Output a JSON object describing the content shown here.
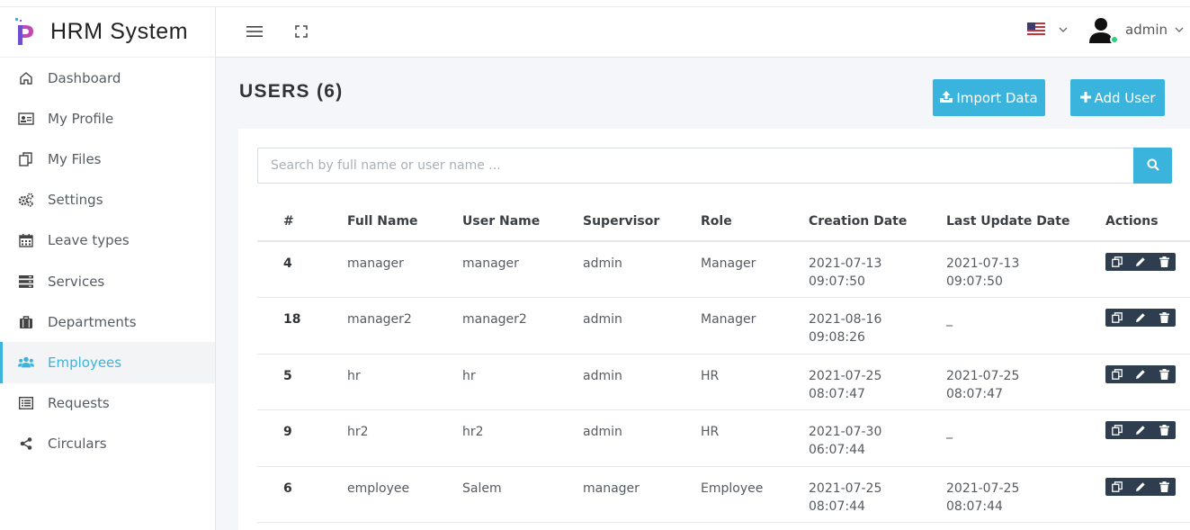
{
  "app": {
    "title": "HRM System"
  },
  "sidebar": {
    "items": [
      {
        "label": "Dashboard",
        "icon": "home-icon",
        "active": false
      },
      {
        "label": "My Profile",
        "icon": "id-card-icon",
        "active": false
      },
      {
        "label": "My Files",
        "icon": "copy-icon",
        "active": false
      },
      {
        "label": "Settings",
        "icon": "cogs-icon",
        "active": false
      },
      {
        "label": "Leave types",
        "icon": "calendar-icon",
        "active": false
      },
      {
        "label": "Services",
        "icon": "server-icon",
        "active": false
      },
      {
        "label": "Departments",
        "icon": "briefcase-icon",
        "active": false
      },
      {
        "label": "Employees",
        "icon": "users-icon",
        "active": true
      },
      {
        "label": "Requests",
        "icon": "list-icon",
        "active": false
      },
      {
        "label": "Circulars",
        "icon": "share-icon",
        "active": false
      }
    ]
  },
  "header": {
    "menu_icon": "hamburger-icon",
    "fullscreen_icon": "expand-icon",
    "language_icon": "us-flag-icon",
    "user": {
      "name": "admin",
      "status": "online"
    }
  },
  "page": {
    "title": "USERS (6)",
    "import_label": "Import Data",
    "add_label": "Add User"
  },
  "search": {
    "placeholder": "Search by full name or user name ..."
  },
  "table": {
    "headers": [
      "#",
      "Full Name",
      "User Name",
      "Supervisor",
      "Role",
      "Creation Date",
      "Last Update Date",
      "Actions"
    ],
    "rows": [
      {
        "id": "4",
        "full_name": "manager",
        "user_name": "manager",
        "supervisor": "admin",
        "role": "Manager",
        "created_date": "2021-07-13",
        "created_time": "09:07:50",
        "updated_date": "2021-07-13",
        "updated_time": "09:07:50"
      },
      {
        "id": "18",
        "full_name": "manager2",
        "user_name": "manager2",
        "supervisor": "admin",
        "role": "Manager",
        "created_date": "2021-08-16",
        "created_time": "09:08:26",
        "updated_date": "_",
        "updated_time": ""
      },
      {
        "id": "5",
        "full_name": "hr",
        "user_name": "hr",
        "supervisor": "admin",
        "role": "HR",
        "created_date": "2021-07-25",
        "created_time": "08:07:47",
        "updated_date": "2021-07-25",
        "updated_time": "08:07:47"
      },
      {
        "id": "9",
        "full_name": "hr2",
        "user_name": "hr2",
        "supervisor": "admin",
        "role": "HR",
        "created_date": "2021-07-30",
        "created_time": "06:07:44",
        "updated_date": "_",
        "updated_time": ""
      },
      {
        "id": "6",
        "full_name": "employee",
        "user_name": "Salem",
        "supervisor": "manager",
        "role": "Employee",
        "created_date": "2021-07-25",
        "created_time": "08:07:44",
        "updated_date": "2021-07-25",
        "updated_time": "08:07:44"
      }
    ]
  },
  "colors": {
    "accent": "#3ab4dc",
    "actions_bg": "#2f3e4e",
    "online": "#28d17c"
  }
}
